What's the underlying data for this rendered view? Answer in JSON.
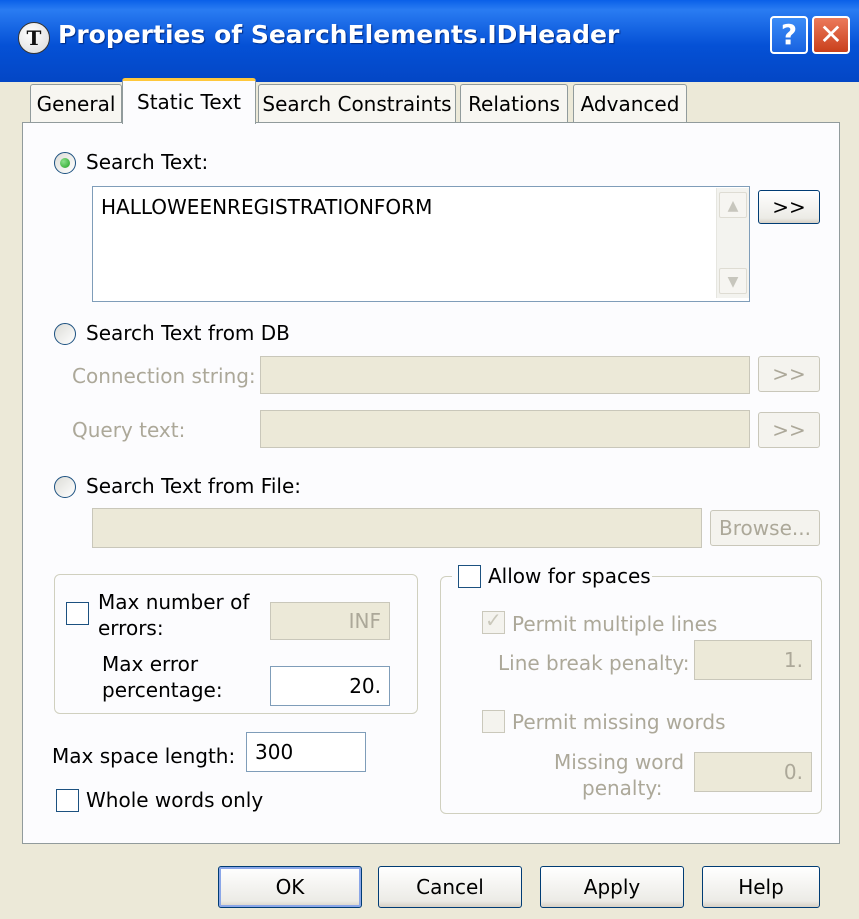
{
  "window": {
    "title": "Properties of SearchElements.IDHeader",
    "app_icon_glyph": "T",
    "help_glyph": "?",
    "close_glyph": "✕"
  },
  "tabs": [
    {
      "label": "General"
    },
    {
      "label": "Static Text",
      "active": true
    },
    {
      "label": "Search Constraints"
    },
    {
      "label": "Relations"
    },
    {
      "label": "Advanced"
    }
  ],
  "search_text": {
    "radio_label": "Search Text:",
    "selected": true,
    "value": "HALLOWEENREGISTRATIONFORM",
    "expand_button": ">>"
  },
  "search_db": {
    "radio_label": "Search Text from DB",
    "connection_label": "Connection string:",
    "connection_value": "",
    "connection_button": ">>",
    "query_label": "Query text:",
    "query_value": "",
    "query_button": ">>"
  },
  "search_file": {
    "radio_label": "Search Text from File:",
    "path_value": "",
    "browse_button": "Browse..."
  },
  "errors": {
    "max_errors_label_1": "Max number of",
    "max_errors_label_2": "errors:",
    "max_errors_value": "INF",
    "max_error_pct_label_1": "Max error",
    "max_error_pct_label_2": "percentage:",
    "max_error_pct_value": "20."
  },
  "space": {
    "max_space_label": "Max space length:",
    "max_space_value": "300",
    "whole_words_label": "Whole words only"
  },
  "allow_spaces": {
    "label": "Allow for spaces",
    "permit_multiple_label": "Permit multiple lines",
    "permit_multiple_checked": true,
    "line_break_label": "Line break penalty:",
    "line_break_value": "1.",
    "permit_missing_label": "Permit missing words",
    "missing_penalty_label_1": "Missing word",
    "missing_penalty_label_2": "penalty:",
    "missing_penalty_value": "0."
  },
  "footer": {
    "ok": "OK",
    "cancel": "Cancel",
    "apply": "Apply",
    "help": "Help"
  },
  "colors": {
    "titlebar": "#0551d6",
    "dialog_bg": "#ece9d8",
    "active_tab_accent": "#ffc83c",
    "disabled_text": "#aca899"
  }
}
